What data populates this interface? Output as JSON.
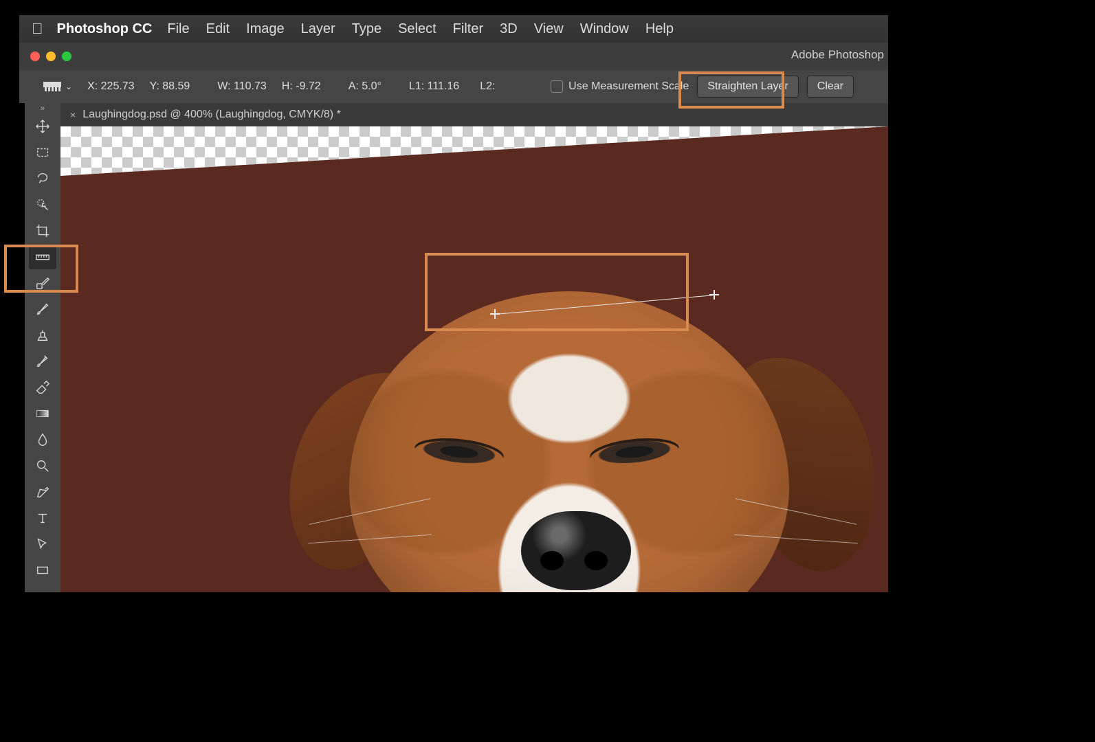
{
  "menubar": {
    "app": "Photoshop CC",
    "items": [
      "File",
      "Edit",
      "Image",
      "Layer",
      "Type",
      "Select",
      "Filter",
      "3D",
      "View",
      "Window",
      "Help"
    ]
  },
  "window": {
    "title": "Adobe Photoshop"
  },
  "optionsBar": {
    "x_label": "X:",
    "x_value": "225.73",
    "y_label": "Y:",
    "y_value": "88.59",
    "w_label": "W:",
    "w_value": "110.73",
    "h_label": "H:",
    "h_value": "-9.72",
    "a_label": "A:",
    "a_value": "5.0°",
    "l1_label": "L1:",
    "l1_value": "111.16",
    "l2_label": "L2:",
    "l2_value": "",
    "measScale": "Use Measurement Scale",
    "straighten": "Straighten Layer",
    "clear": "Clear"
  },
  "documentTab": {
    "title": "Laughingdog.psd @ 400% (Laughingdog, CMYK/8) *"
  },
  "tools": [
    "move-tool",
    "rectangular-marquee-tool",
    "lasso-tool",
    "quick-selection-tool",
    "crop-tool",
    "ruler-tool",
    "spot-healing-brush-tool",
    "brush-tool",
    "clone-stamp-tool",
    "history-brush-tool",
    "eraser-tool",
    "gradient-tool",
    "blur-tool",
    "dodge-tool",
    "pen-tool",
    "type-tool",
    "path-selection-tool",
    "rectangle-tool"
  ],
  "highlights": {
    "rulerTool": true,
    "straightenButton": true,
    "measureLine": true
  }
}
